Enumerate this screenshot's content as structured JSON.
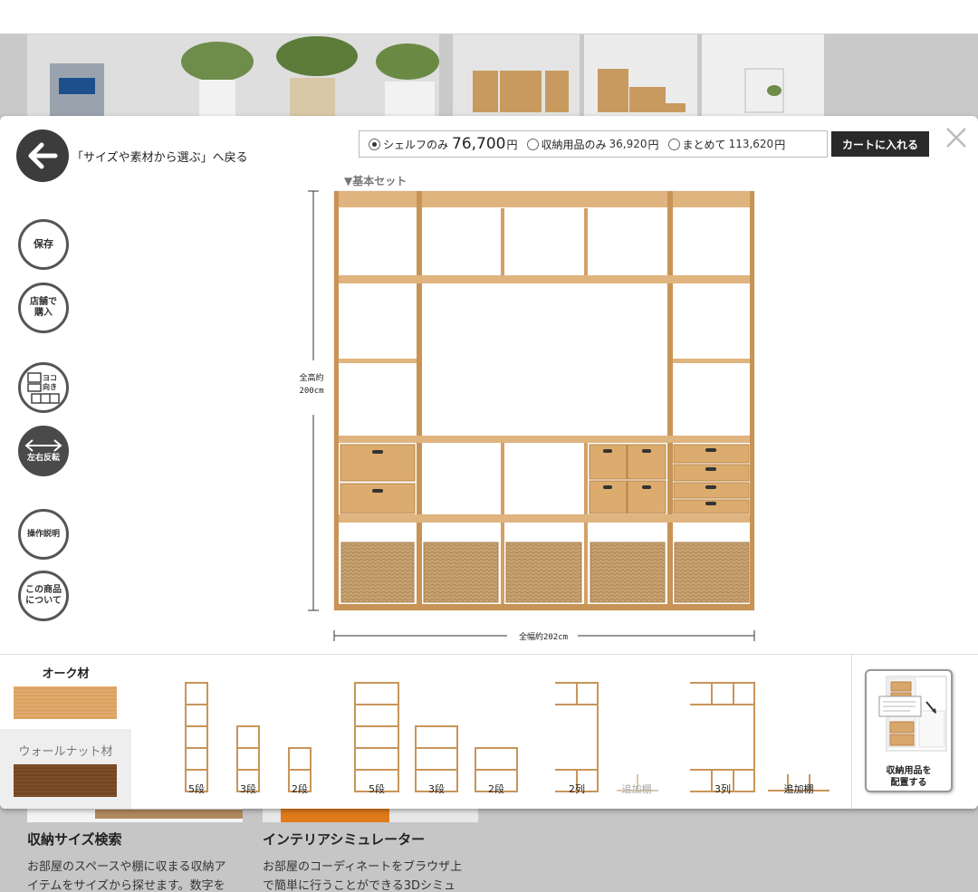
{
  "header": {
    "back_label": "「サイズや素材から選ぶ」へ戻る"
  },
  "price_bar": {
    "options": [
      {
        "label": "シェルフのみ",
        "price": "76,700",
        "yen": "円",
        "selected": true
      },
      {
        "label": "収納用品のみ",
        "price": "36,920",
        "yen": "円",
        "selected": false
      },
      {
        "label": "まとめて",
        "price": "113,620",
        "yen": "円",
        "selected": false
      }
    ],
    "cart_label": "カートに入れる"
  },
  "side_buttons": {
    "save": "保存",
    "store_1": "店舗で",
    "store_2": "購入",
    "orientation_1": "ヨコ",
    "orientation_2": "向き",
    "flip": "左右反転",
    "help": "操作説明",
    "about_1": "この商品",
    "about_2": "について"
  },
  "set_label": "▼基本セット",
  "dimensions": {
    "height_1": "全高約",
    "height_2": "200cm",
    "width": "全幅約202cm"
  },
  "materials": [
    {
      "name": "オーク材",
      "selected": true,
      "color": "#d9a46a"
    },
    {
      "name": "ウォールナット材",
      "selected": false,
      "color": "#7a4a26"
    }
  ],
  "palette": {
    "items": [
      "5段",
      "3段",
      "2段",
      "5段",
      "3段",
      "2段",
      "2列",
      "追加棚",
      "3列",
      "追加棚"
    ],
    "place_label_1": "収納用品を",
    "place_label_2": "配置する"
  },
  "background": {
    "section1_title": "収納サイズ検索",
    "section1_text_1": "お部屋のスペースや棚に収まる収納ア",
    "section1_text_2": "イテムをサイズから探せます。数字を",
    "section2_title": "インテリアシミュレーター",
    "section2_text_1": "お部屋のコーディネートをブラウザ上",
    "section2_text_2": "で簡単に行うことができる3Dシミュ"
  },
  "colors": {
    "wood": "#d7a66d",
    "wood_dark": "#c28f54",
    "basket": "#c9a77a",
    "button_dark": "#3c3c3c"
  }
}
